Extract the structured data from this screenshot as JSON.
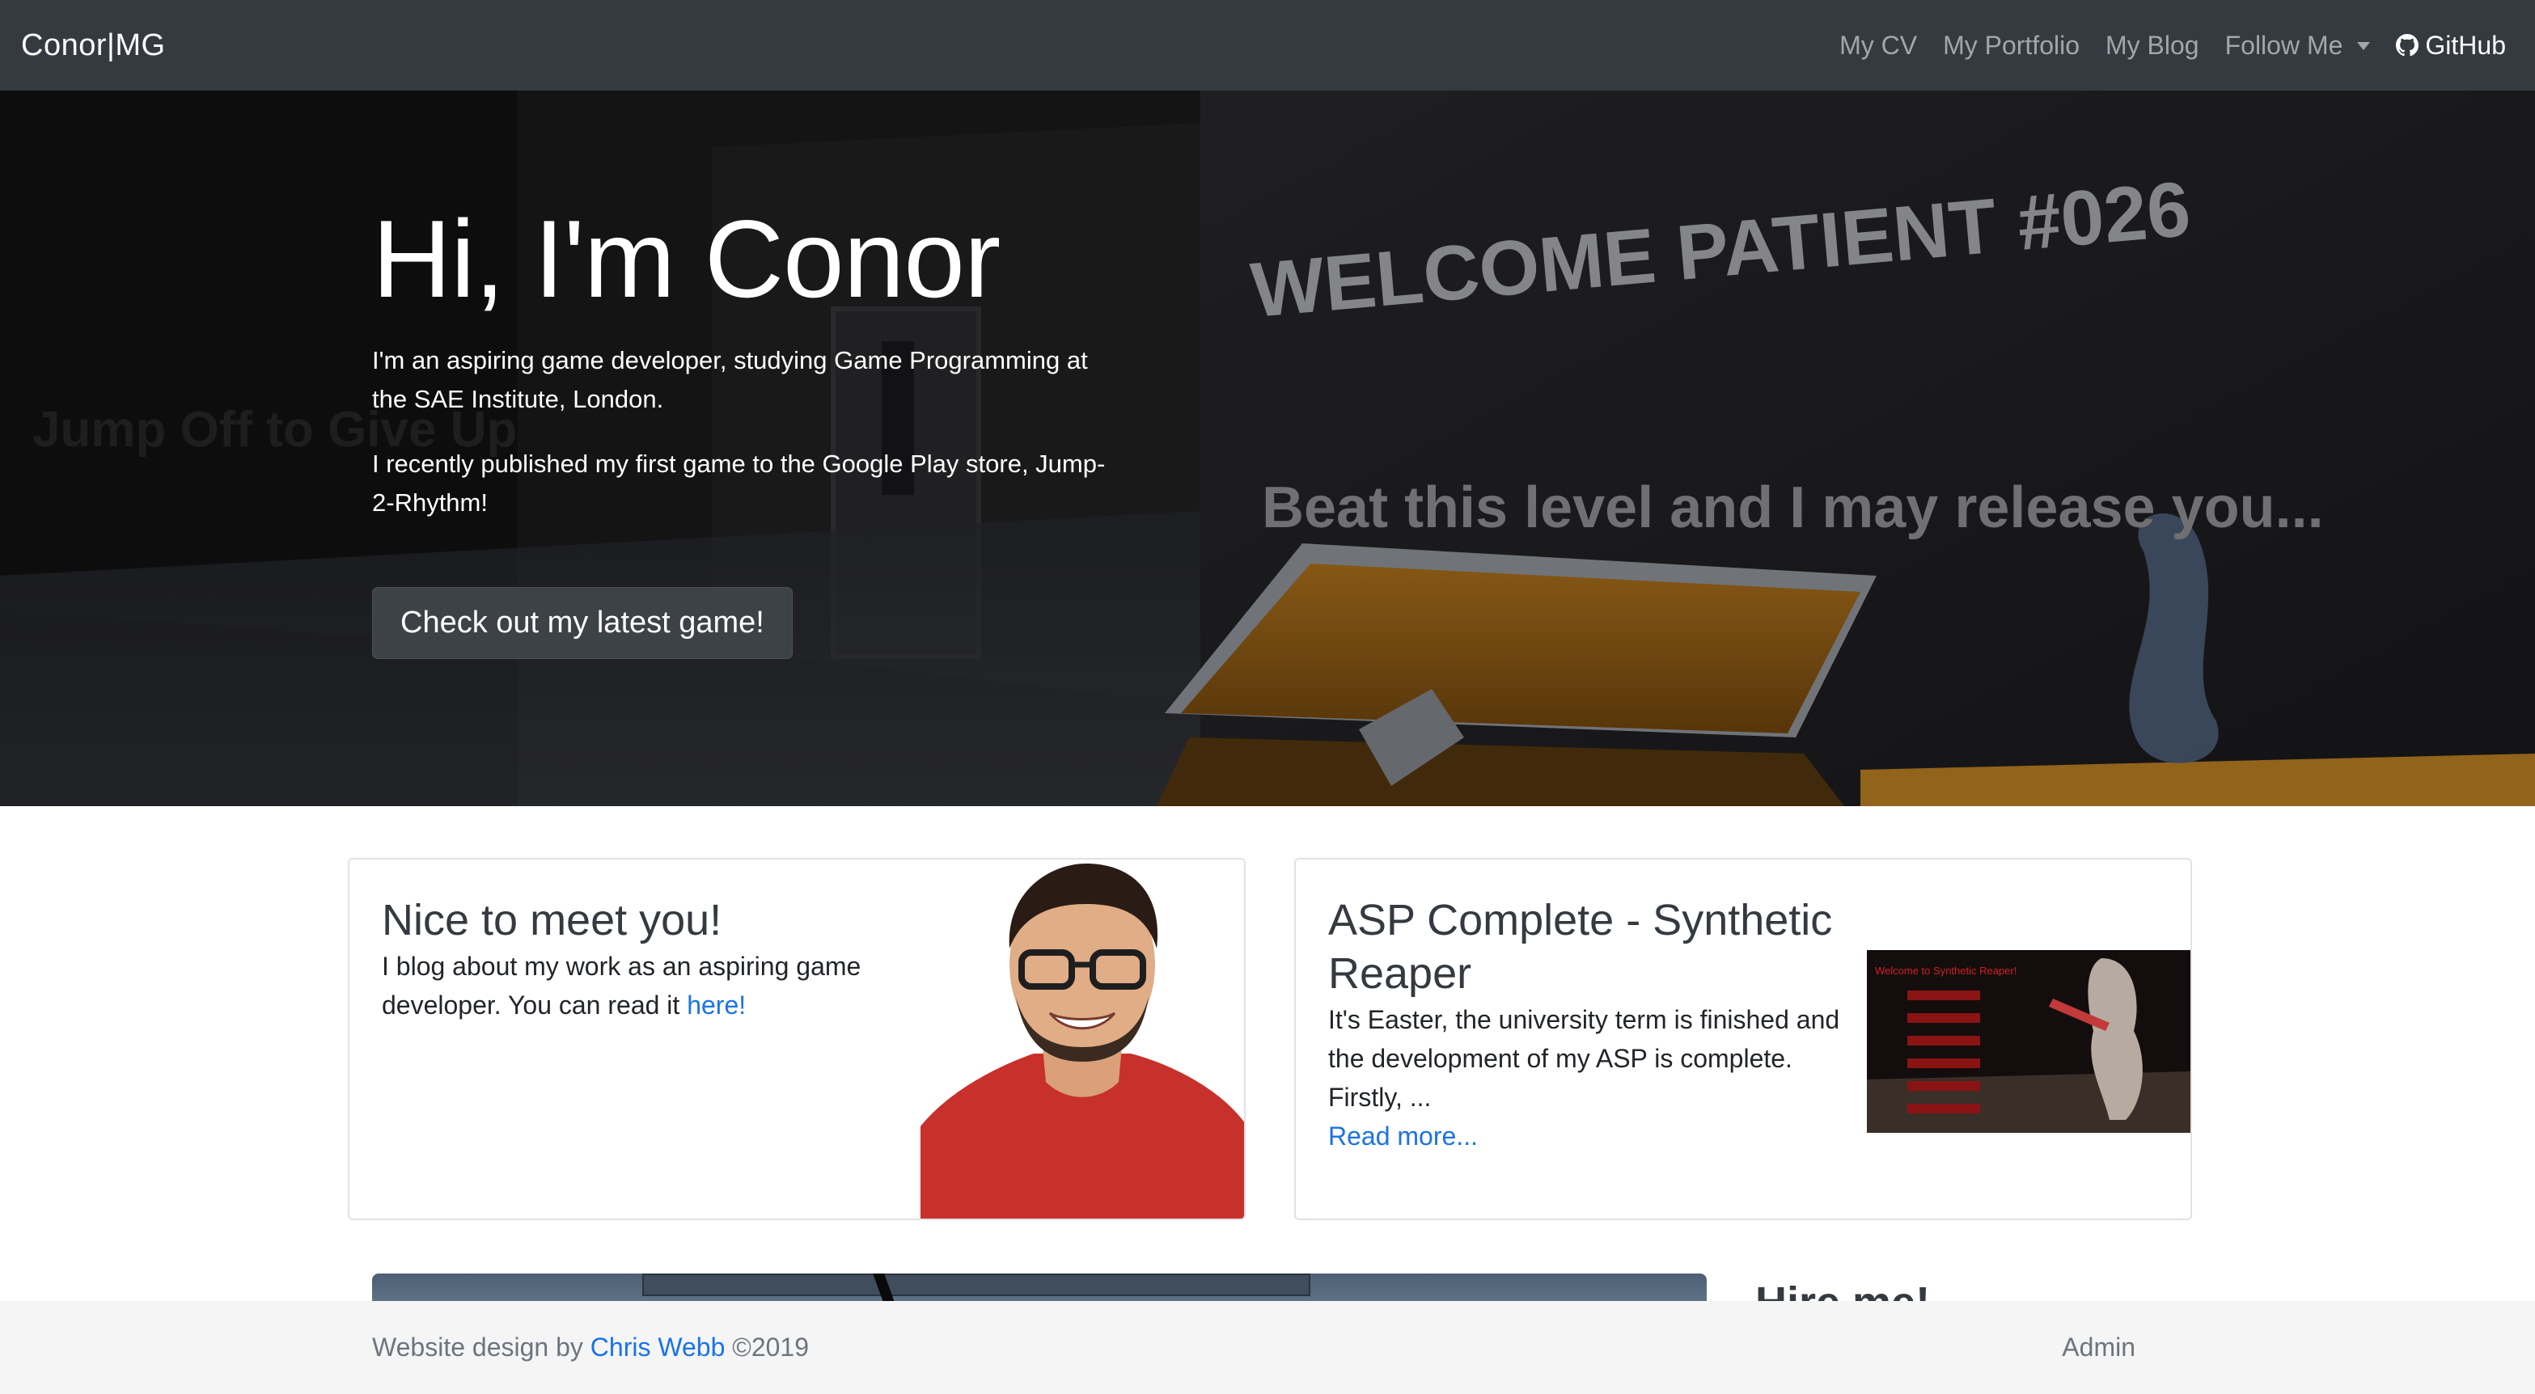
{
  "navbar": {
    "brand": "Conor|MG",
    "links": {
      "cv": "My CV",
      "portfolio": "My Portfolio",
      "blog": "My Blog",
      "follow": "Follow Me",
      "github": "GitHub"
    }
  },
  "hero": {
    "title": "Hi, I'm Conor",
    "paragraph1": "I'm an aspiring game developer, studying Game Programming at the SAE Institute, London.",
    "paragraph2": "I recently published my first game to the Google Play store, Jump-2-Rhythm!",
    "button": "Check out my latest game!",
    "bg_text_1": "WELCOME PATIENT #026",
    "bg_text_2": "Beat this level and I may release you...",
    "bg_text_3": "Jump Off to Give Up"
  },
  "intro_card": {
    "title": "Nice to meet you!",
    "text": "I blog about my work as an aspiring game developer. You can read it ",
    "link": "here!"
  },
  "post_card": {
    "title": "ASP Complete - Synthetic Reaper",
    "excerpt": "It's Easter, the university term is finished and the development of my ASP is complete. Firstly, ...",
    "read_more": "Read more...",
    "thumb_caption": "Welcome to Synthetic Reaper!"
  },
  "sidebar": {
    "hire_heading": "Hire me!"
  },
  "footer": {
    "credit_prefix": "Website design by ",
    "credit_name": "Chris Webb",
    "credit_suffix": " ©2019",
    "admin": "Admin"
  },
  "colors": {
    "navbar": "#343a40",
    "link": "#1a73e8",
    "footer_bg": "#f5f5f5"
  }
}
